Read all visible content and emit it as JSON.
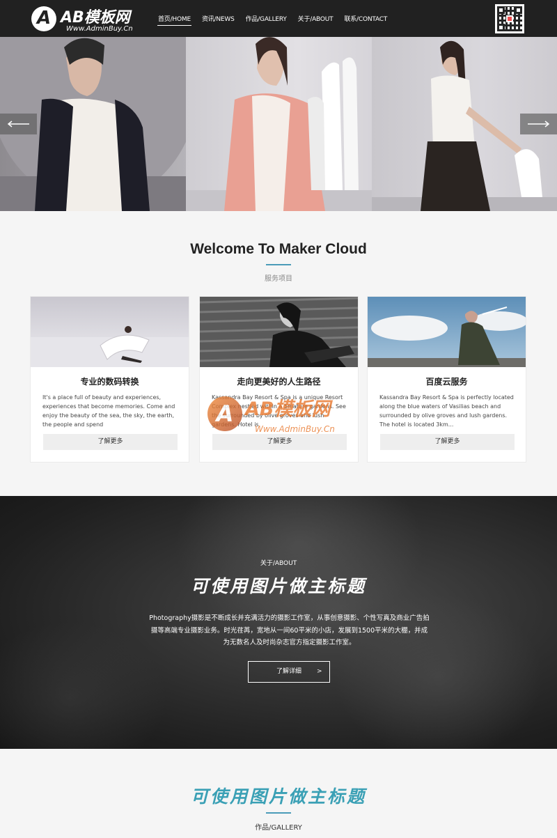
{
  "header": {
    "logo_mark": "A",
    "logo_title": "AB模板网",
    "logo_sub": "Www.AdminBuy.Cn",
    "nav": [
      {
        "label": "首页/HOME",
        "active": true
      },
      {
        "label": "资讯/NEWS",
        "active": false
      },
      {
        "label": "作品/GALLERY",
        "active": false
      },
      {
        "label": "关于/ABOUT",
        "active": false
      },
      {
        "label": "联系/CONTACT",
        "active": false
      }
    ]
  },
  "hero": {
    "icons": {
      "prev": "arrow-left-icon",
      "next": "arrow-right-icon"
    }
  },
  "welcome": {
    "title": "Welcome To Maker Cloud",
    "subtitle": "服务项目",
    "accent": "#4a9bb8"
  },
  "cards": [
    {
      "title": "专业的数码转换",
      "text": "It's a place full of beauty and experiences, experiences that become memories. Come and enjoy the beauty of the sea, the sky, the earth, the people and spend",
      "button": "了解更多"
    },
    {
      "title": "走向更美好的人生路径",
      "text": "Kassandra Bay Resort & Spa is a unique Resort Complex nestled within a 5mature gardens. See the surrounded by olive groves and lush gardens. Hotel is",
      "button": "了解更多"
    },
    {
      "title": "百度云服务",
      "text": "Kassandra Bay Resort & Spa is perfectly located along the blue waters of Vasilias beach and surrounded by olive groves and lush gardens. The hotel is located 3km...",
      "button": "了解更多"
    }
  ],
  "watermark": {
    "mark": "A",
    "title": "AB模板网",
    "sub": "Www.AdminBuy.Cn",
    "color": "#e8782e"
  },
  "about": {
    "kicker": "关于/ABOUT",
    "title": "可使用图片做主标题",
    "text": "Photography摄影是不断成长并充满活力的摄影工作室，从事创意摄影、个性写真及商业广告拍摄等高端专业摄影业务。时光荏苒，宽地从一间60平米的小店，发展到1500平米的大棚，并成为无数名人及时尚杂志官方指定摄影工作室。",
    "button": "了解详细",
    "button_chevron": ">"
  },
  "gallery": {
    "title": "可使用图片做主标题",
    "subtitle": "作品/GALLERY",
    "accent": "#3aa0b5"
  }
}
